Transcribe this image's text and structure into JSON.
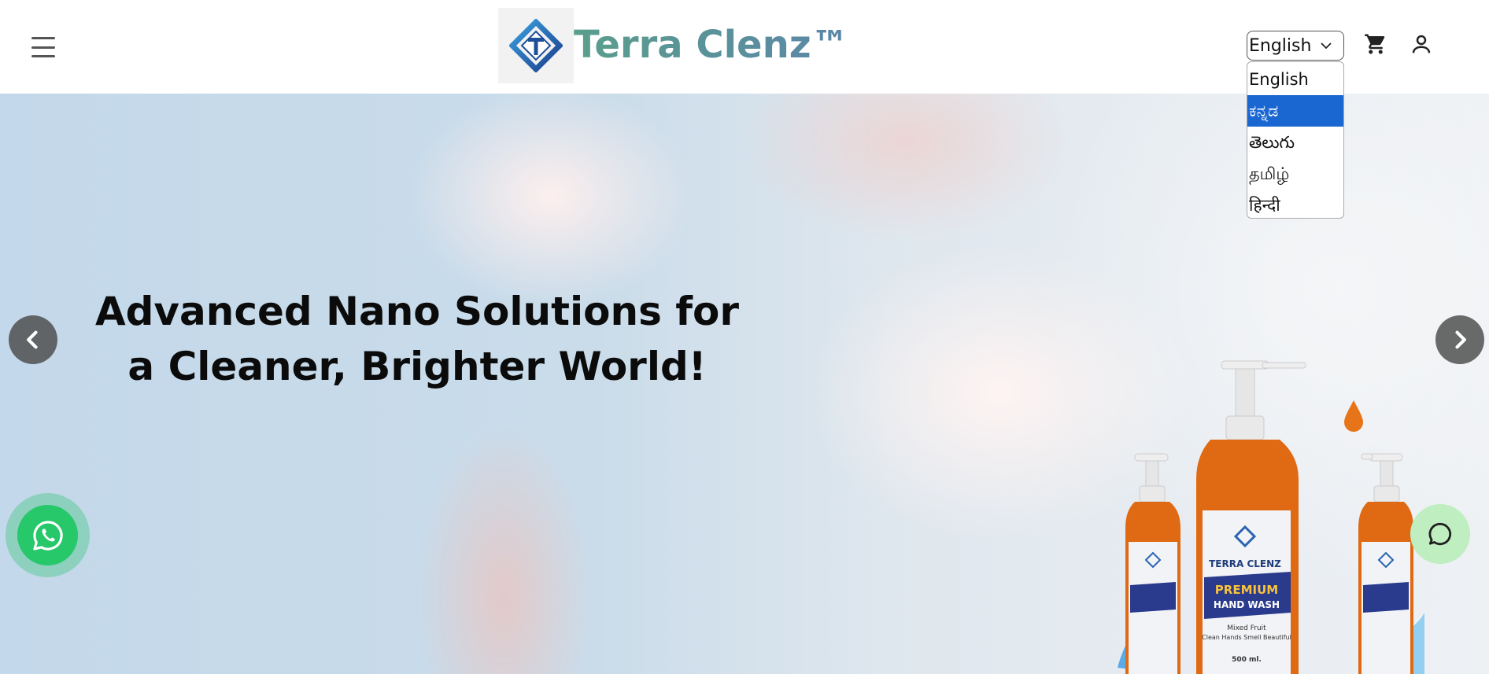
{
  "header": {
    "brand_name": "Terra Clenz™",
    "logo_letter": "T",
    "menu_icon": "hamburger-menu-icon",
    "cart_icon": "cart-icon",
    "account_icon": "user-icon"
  },
  "language": {
    "selected": "English",
    "options": [
      "English",
      "ಕನ್ನಡ",
      "తెలుగు",
      "தமிழ்",
      "हिन्दी"
    ],
    "highlighted_option": "ಕನ್ನಡ"
  },
  "hero": {
    "headline_line1": "Advanced Nano Solutions for",
    "headline_line2": "a Cleaner, Brighter World!",
    "prev_icon": "chevron-left-icon",
    "next_icon": "chevron-right-icon"
  },
  "product_image": {
    "brand": "TERRA CLENZ",
    "line1": "PREMIUM",
    "line2": "HAND WASH",
    "variant": "Mixed Fruit",
    "tagline": "Clean Hands Smell Beautiful",
    "volume": "500 ml."
  },
  "floating": {
    "whatsapp_icon": "whatsapp-icon",
    "chat_icon": "chat-bubble-icon"
  },
  "colors": {
    "brand_teal": "#4e8f86",
    "brand_blue": "#2a64b0",
    "dropdown_highlight": "#1a67d2",
    "whatsapp_green": "#26c86a",
    "chat_green": "#bfeec0"
  }
}
